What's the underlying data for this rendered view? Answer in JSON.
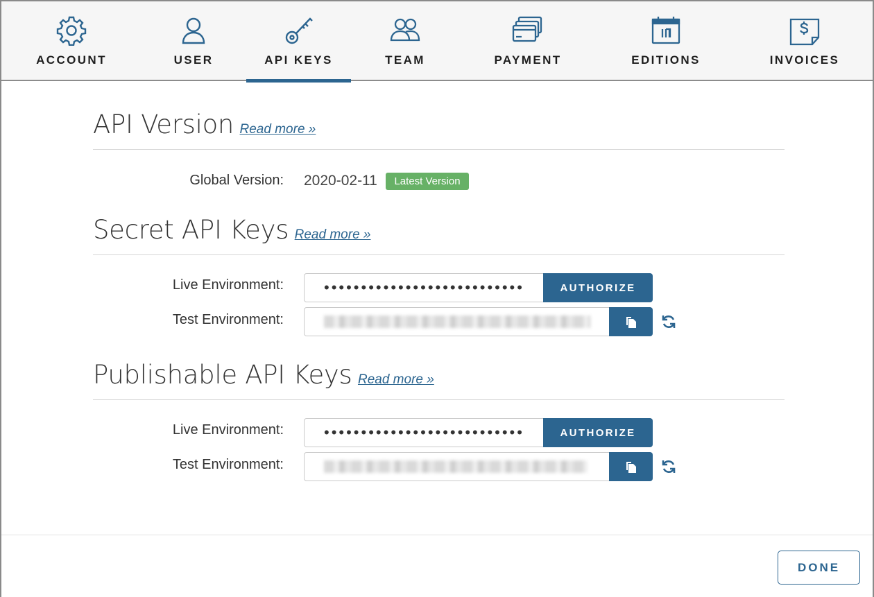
{
  "nav": {
    "tabs": [
      {
        "label": "ACCOUNT",
        "icon": "gear-icon"
      },
      {
        "label": "USER",
        "icon": "user-icon"
      },
      {
        "label": "API KEYS",
        "icon": "key-icon",
        "active": true
      },
      {
        "label": "TEAM",
        "icon": "team-icon"
      },
      {
        "label": "PAYMENT",
        "icon": "credit-cards-icon"
      },
      {
        "label": "EDITIONS",
        "icon": "calendar-icon"
      },
      {
        "label": "INVOICES",
        "icon": "invoice-icon"
      }
    ]
  },
  "api_version": {
    "title": "API Version",
    "read_more": "Read more »",
    "label": "Global Version:",
    "value": "2020-02-11",
    "badge": "Latest Version"
  },
  "secret_keys": {
    "title": "Secret API Keys",
    "read_more": "Read more »",
    "live_label": "Live Environment:",
    "live_value": "•••••••••••••••••••••••••••",
    "authorize": "AUTHORIZE",
    "test_label": "Test Environment:"
  },
  "publishable_keys": {
    "title": "Publishable API Keys",
    "read_more": "Read more »",
    "live_label": "Live Environment:",
    "live_value": "•••••••••••••••••••••••••••",
    "authorize": "AUTHORIZE",
    "test_label": "Test Environment:"
  },
  "footer": {
    "done": "DONE"
  },
  "colors": {
    "accent": "#2c6590",
    "badge": "#67b166"
  }
}
